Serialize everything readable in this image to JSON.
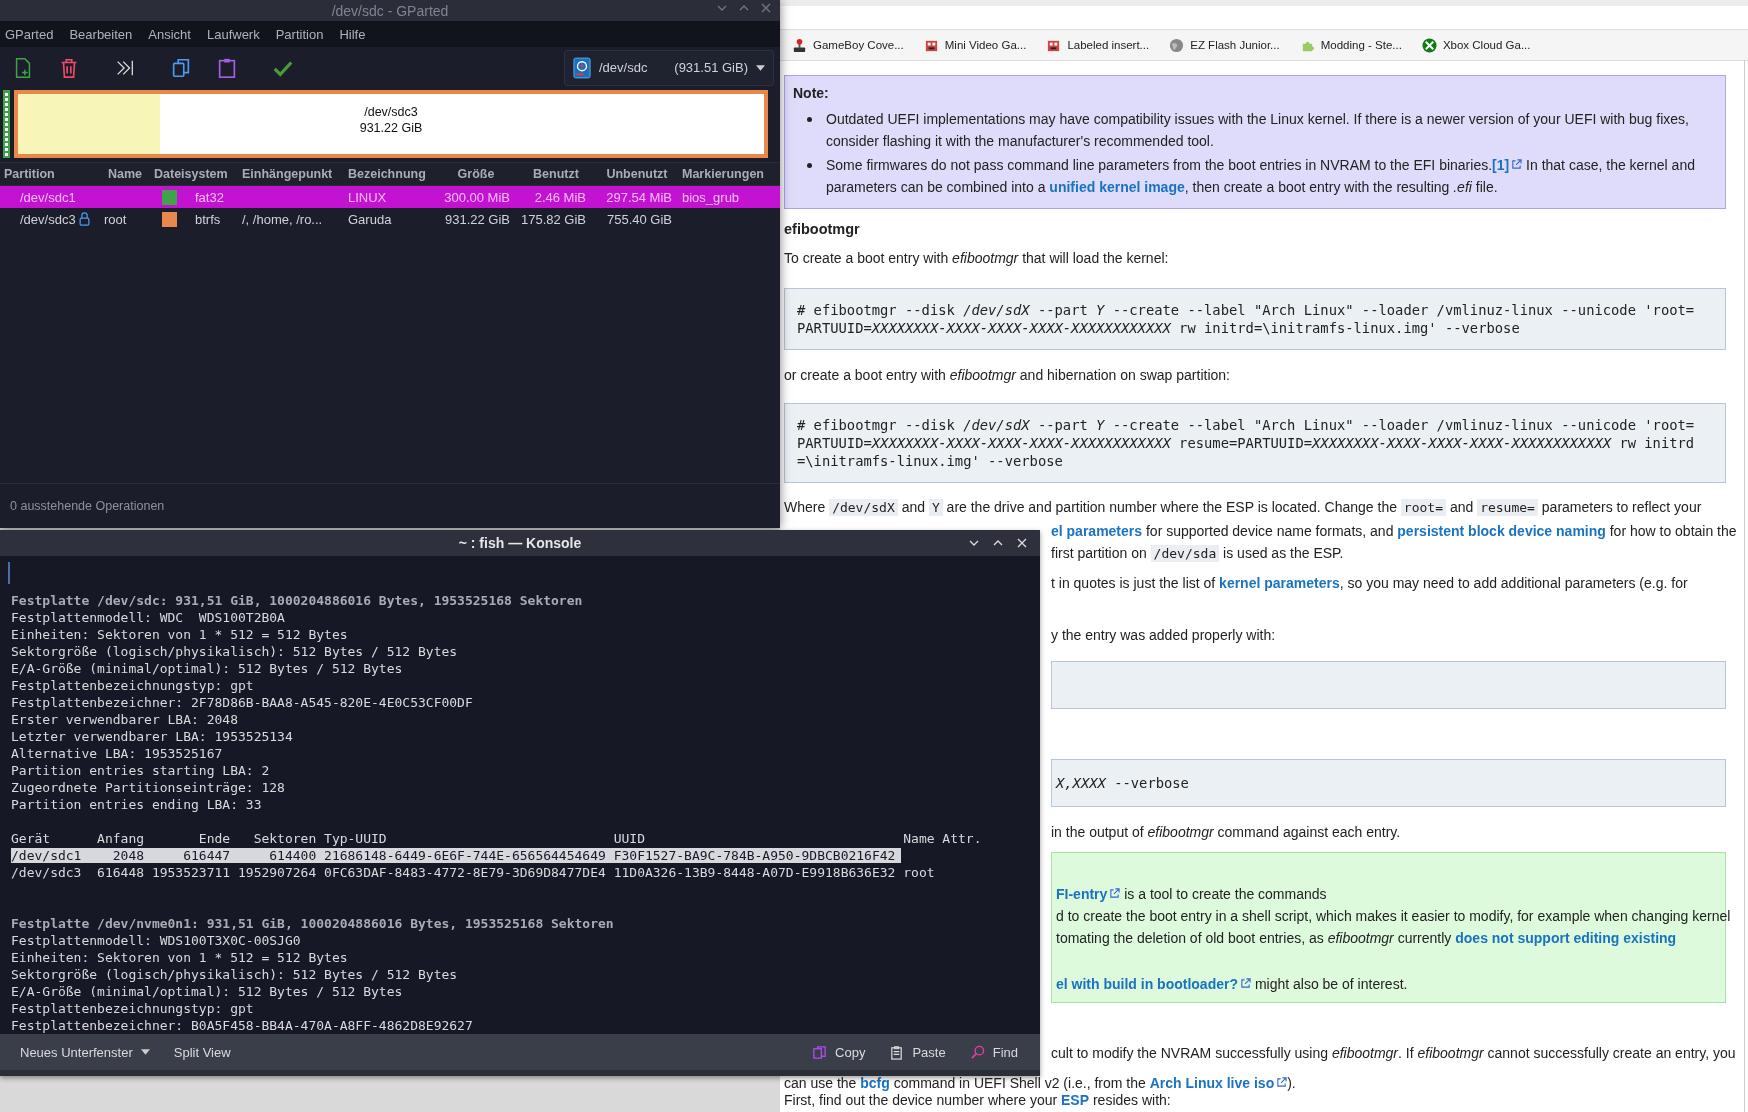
{
  "gparted": {
    "title": "/dev/sdc - GParted",
    "menu": [
      "GParted",
      "Bearbeiten",
      "Ansicht",
      "Laufwerk",
      "Partition",
      "Hilfe"
    ],
    "device": {
      "name": "/dev/sdc",
      "size": "(931.51 GiB)"
    },
    "disk_map": {
      "label": "/dev/sdc3",
      "size": "931.22 GiB",
      "level": 0.19
    },
    "columns": [
      "Partition",
      "Name",
      "Dateisystem",
      "Einhängepunkt",
      "Bezeichnung",
      "Größe",
      "Benutzt",
      "Unbenutzt",
      "Markierungen"
    ],
    "rows": [
      {
        "partition": "/dev/sdc1",
        "locked": false,
        "color": "#3fa34a",
        "filesystem": "fat32",
        "label": "LINUX",
        "size": "300.00 MiB",
        "used": "2.46 MiB",
        "unused": "297.54 MiB",
        "flags": "bios_grub",
        "selected": true
      },
      {
        "partition": "/dev/sdc3",
        "locked": true,
        "name": "root",
        "color": "#e8884a",
        "filesystem": "btrfs",
        "mountpoint": "/, /home, /ro...",
        "label": "Garuda",
        "size": "931.22 GiB",
        "used": "175.82 GiB",
        "unused": "755.40 GiB",
        "selected": false
      }
    ],
    "status": "0 ausstehende Operationen"
  },
  "browser": {
    "bookmarks": [
      {
        "label": "GameBoy Cove...",
        "kind": "joystick"
      },
      {
        "label": "Mini Video Ga...",
        "kind": "sprite"
      },
      {
        "label": "Labeled insert...",
        "kind": "sprite"
      },
      {
        "label": "EZ Flash Junior...",
        "kind": "globe"
      },
      {
        "label": "Modding - Ste...",
        "kind": "puzzle"
      },
      {
        "label": "Xbox Cloud Ga...",
        "kind": "xbox"
      }
    ],
    "blocks": [
      {
        "kind": "note",
        "title": "Note:",
        "items": [
          {
            "lines": [
              [
                {
                  "kind": "text",
                  "text": "Outdated UEFI implementations may have compatibility issues with the Linux kernel. If there is a newer version of your UEFI with bug fixes,"
                }
              ],
              [
                {
                  "kind": "text",
                  "text": "consider flashing it with the manufacturer's recommended tool."
                }
              ]
            ]
          },
          {
            "lines": [
              [
                {
                  "kind": "text",
                  "text": "Some firmwares do not pass command line parameters from the boot entries in NVRAM to the EFI binaries."
                },
                {
                  "kind": "link",
                  "text": "[1]",
                  "external": true
                },
                {
                  "kind": "text",
                  "text": " In that case, the kernel and"
                }
              ],
              [
                {
                  "kind": "text",
                  "text": "parameters can be combined into a "
                },
                {
                  "kind": "link",
                  "text": "unified kernel image",
                  "external": false
                },
                {
                  "kind": "text",
                  "text": ", then create a boot entry with the resulting *.efi* file."
                }
              ]
            ]
          }
        ]
      },
      {
        "kind": "heading",
        "text": "efibootmgr"
      },
      {
        "kind": "para",
        "lines": [
          [
            {
              "kind": "text",
              "text": "To create a boot entry with *efibootmgr* that will load the kernel:"
            }
          ]
        ]
      },
      {
        "kind": "code",
        "lines": [
          "# efibootmgr --disk */dev/sdX* --part *Y* --create --label \"Arch Linux\" --loader /vmlinuz-linux --unicode 'root=",
          "PARTUUID=*XXXXXXXX-XXXX-XXXX-XXXX-XXXXXXXXXXXX* rw initrd=\\initramfs-linux.img' --verbose"
        ]
      },
      {
        "kind": "para",
        "lines": [
          [
            {
              "kind": "text",
              "text": "or create a boot entry with *efibootmgr* and hibernation on swap partition:"
            }
          ]
        ]
      },
      {
        "kind": "code",
        "lines": [
          "# efibootmgr --disk */dev/sdX* --part *Y* --create --label \"Arch Linux\" --loader /vmlinuz-linux --unicode 'root=",
          "PARTUUID=*XXXXXXXX-XXXX-XXXX-XXXX-XXXXXXXXXXXX* resume=PARTUUID=*XXXXXXXX-XXXX-XXXX-XXXX-XXXXXXXXXXXX* rw initrd",
          "=\\initramfs-linux.img' --verbose"
        ]
      },
      {
        "kind": "para",
        "lines": [
          [
            {
              "kind": "text",
              "text": "Where "
            },
            {
              "kind": "code",
              "text": "/dev/sdX"
            },
            {
              "kind": "text",
              "text": " and "
            },
            {
              "kind": "code",
              "text": "Y"
            },
            {
              "kind": "text",
              "text": " are the drive and partition number where the ESP is located. Change the "
            },
            {
              "kind": "code",
              "text": "root="
            },
            {
              "kind": "text",
              "text": " and "
            },
            {
              "kind": "code",
              "text": "resume="
            },
            {
              "kind": "text",
              "text": " parameters to reflect your"
            }
          ]
        ]
      },
      {
        "kind": "para",
        "lines": [
          [
            {
              "kind": "link",
              "text": "el parameters",
              "external": false
            },
            {
              "kind": "text",
              "text": " for supported device name formats, and "
            },
            {
              "kind": "link",
              "text": "persistent block device naming",
              "external": false
            },
            {
              "kind": "text",
              "text": " for how to obtain the"
            }
          ],
          [
            {
              "kind": "text",
              "text": "first partition on "
            },
            {
              "kind": "code",
              "text": "/dev/sda"
            },
            {
              "kind": "text",
              "text": " is used as the ESP."
            }
          ]
        ]
      },
      {
        "kind": "para",
        "lines": [
          [
            {
              "kind": "text",
              "text": "t in quotes is just the list of "
            },
            {
              "kind": "link",
              "text": "kernel parameters",
              "external": false
            },
            {
              "kind": "text",
              "text": ", so you may need to add additional parameters (e.g. for"
            }
          ]
        ]
      },
      {
        "kind": "para",
        "lines": [
          [
            {
              "kind": "text",
              "text": "y the entry was added properly with:"
            }
          ]
        ]
      },
      {
        "kind": "blank_code"
      },
      {
        "kind": "code",
        "lines": [
          "*X,XXXX* --verbose"
        ]
      },
      {
        "kind": "para",
        "lines": [
          [
            {
              "kind": "text",
              "text": "in the output of *efibootmgr* command against each entry."
            }
          ]
        ]
      },
      {
        "kind": "tip",
        "lines": [
          [
            {
              "kind": "link",
              "text": "FI-entry",
              "external": true
            },
            {
              "kind": "text",
              "text": " is a tool to create the commands"
            }
          ],
          [
            {
              "kind": "text",
              "text": "d to create the boot entry in a shell script, which makes it easier to modify, for example when changing kernel"
            }
          ],
          [
            {
              "kind": "text",
              "text": "tomating the deletion of old boot entries, as *efibootmgr* currently "
            },
            {
              "kind": "link",
              "text": "does not support editing existing",
              "external": false
            }
          ],
          [
            {
              "kind": "link",
              "text": "el with build in bootloader?",
              "external": true
            },
            {
              "kind": "text",
              "text": " might also be of interest."
            }
          ]
        ]
      },
      {
        "kind": "para",
        "lines": [
          [
            {
              "kind": "text",
              "text": "cult to modify the NVRAM successfully using *efibootmgr*. If *efibootmgr* cannot successfully create an entry, you"
            }
          ]
        ]
      },
      {
        "kind": "para",
        "lines": [
          [
            {
              "kind": "text",
              "text": "can use the "
            },
            {
              "kind": "link",
              "text": "bcfg",
              "external": false
            },
            {
              "kind": "text",
              "text": " command in UEFI Shell v2 (i.e., from the "
            },
            {
              "kind": "link",
              "text": "Arch Linux live iso",
              "external": true
            },
            {
              "kind": "text",
              "text": ")."
            }
          ]
        ]
      },
      {
        "kind": "para",
        "lines": [
          [
            {
              "kind": "text",
              "text": "First, find out the device number where your "
            },
            {
              "kind": "link",
              "text": "ESP",
              "external": false
            },
            {
              "kind": "text",
              "text": " resides with:"
            }
          ]
        ]
      }
    ]
  },
  "konsole": {
    "title": "~ : fish — Konsole",
    "disk_1": {
      "heading": "Festplatte /dev/sdc: 931,51 GiB, 1000204886016 Bytes, 1953525168 Sektoren",
      "lines": [
        "Festplattenmodell: WDC  WDS100T2B0A",
        "Einheiten: Sektoren von 1 * 512 = 512 Bytes",
        "Sektorgröße (logisch/physikalisch): 512 Bytes / 512 Bytes",
        "E/A-Größe (minimal/optimal): 512 Bytes / 512 Bytes",
        "Festplattenbezeichnungstyp: gpt",
        "Festplattenbezeichner: 2F78D86B-BAA8-A545-820E-4E0C53CF00DF",
        "Erster verwendbarer LBA: 2048",
        "Letzter verwendbarer LBA: 1953525134",
        "Alternative LBA: 1953525167",
        "Partition entries starting LBA: 2",
        "Zugeordnete Partitionseinträge: 128",
        "Partition entries ending LBA: 33"
      ]
    },
    "partition_table": {
      "header": "Gerät      Anfang       Ende   Sektoren Typ-UUID                             UUID                                 Name Attr.",
      "rows": [
        {
          "text": "/dev/sdc1    2048     616447     614400 21686148-6449-6E6F-744E-656564454649 F30F1527-BA9C-784B-A950-9DBCB0216F42",
          "selected": true
        },
        {
          "text": "/dev/sdc3  616448 1953523711 1952907264 0FC63DAF-8483-4772-8E79-3D69D8477DE4 11D0A326-13B9-8448-A07D-E9918B636E32 root",
          "selected": false
        }
      ]
    },
    "disk_2": {
      "heading": "Festplatte /dev/nvme0n1: 931,51 GiB, 1000204886016 Bytes, 1953525168 Sektoren",
      "lines": [
        "Festplattenmodell: WDS100T3X0C-00SJG0",
        "Einheiten: Sektoren von 1 * 512 = 512 Bytes",
        "Sektorgröße (logisch/physikalisch): 512 Bytes / 512 Bytes",
        "E/A-Größe (minimal/optimal): 512 Bytes / 512 Bytes",
        "Festplattenbezeichnungstyp: gpt",
        "Festplattenbezeichner: B0A5F458-BB4A-470A-A8FF-4862D8E92627"
      ]
    },
    "toolbar_left": [
      {
        "label": "Neues Unterfenster",
        "kind": "menu"
      },
      {
        "label": "Split View",
        "kind": "button"
      }
    ],
    "toolbar_right": [
      {
        "label": "Copy",
        "kind": "copy"
      },
      {
        "label": "Paste",
        "kind": "paste"
      },
      {
        "label": "Find",
        "kind": "find"
      }
    ]
  }
}
